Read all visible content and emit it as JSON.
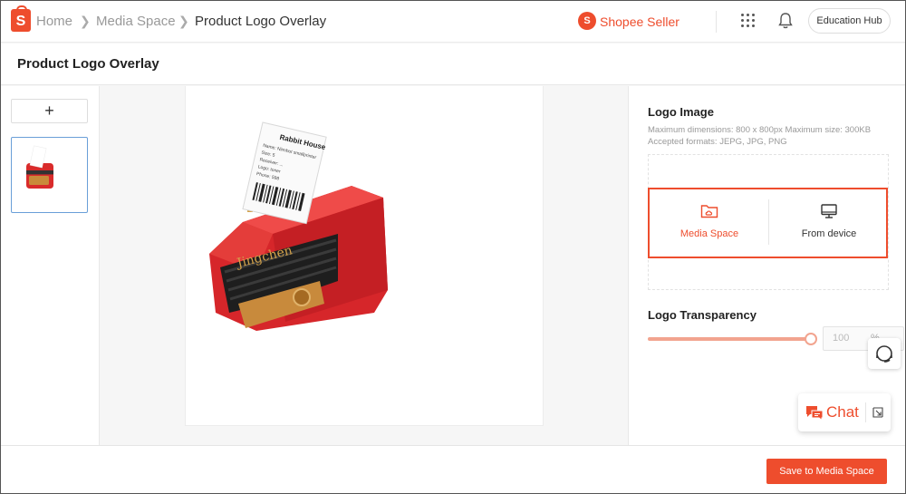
{
  "colors": {
    "accent": "#ee4d2d",
    "slider": "#f2a48f",
    "selected_thumb_border": "#6a9fd8"
  },
  "header": {
    "logo_letter": "S",
    "breadcrumb": [
      "Home",
      "Media Space",
      "Product Logo Overlay"
    ],
    "brand_text": "Shopee Seller",
    "brand_icon": "shopee-bag-icon",
    "education_hub": "Education Hub"
  },
  "page": {
    "title": "Product Logo Overlay"
  },
  "thumbnails": {
    "add_label": "+",
    "selected_index": 0
  },
  "canvas": {
    "product_image": "red-label-printer",
    "receipt_lines": [
      "Rabbit House",
      "Name: Niimbot smallprinter",
      "Size: 5",
      "Receiver: ...",
      "Logo: toner",
      "Phone: 598"
    ],
    "printer_brand": "Jingchen"
  },
  "logo_image": {
    "title": "Logo Image",
    "hint_dimensions": "Maximum dimensions: 800 x 800px Maximum size: 300KB",
    "hint_formats": "Accepted formats: JEPG, JPG, PNG",
    "option_media": "Media Space",
    "option_device": "From device",
    "icon_media": "folder-cloud-icon",
    "icon_device": "monitor-icon"
  },
  "transparency": {
    "title": "Logo Transparency",
    "value": "100",
    "unit": "%",
    "slider_fraction": 1.0
  },
  "chat": {
    "label": "Chat"
  },
  "footer": {
    "save_label": "Save to Media Space"
  }
}
